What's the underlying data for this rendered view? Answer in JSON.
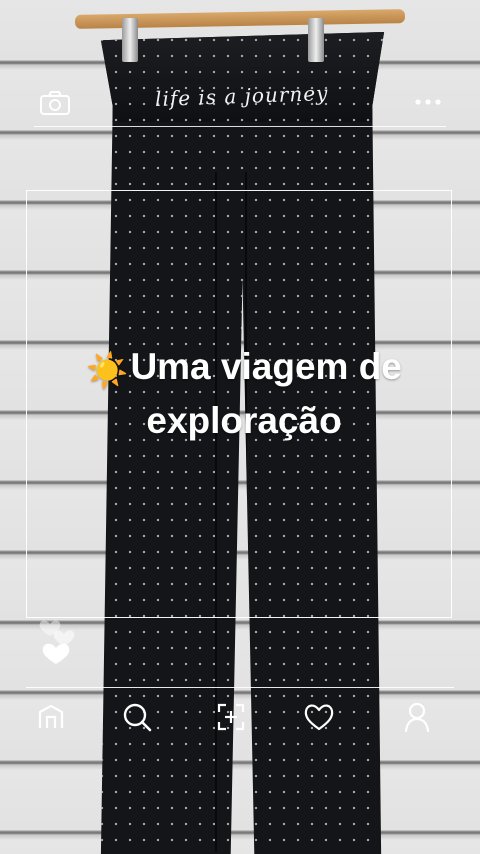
{
  "photo": {
    "embroidery_text": "life is a journey"
  },
  "overlay": {
    "title": "Uma viagem de exploração",
    "title_emoji": "☀️"
  },
  "toolbar": {
    "camera_icon": "camera-icon",
    "more_icon": "more-horizontal-icon"
  },
  "reactions": {
    "icon": "hearts-icon"
  },
  "bottom_nav": {
    "items": [
      {
        "icon": "home-icon"
      },
      {
        "icon": "search-icon"
      },
      {
        "icon": "capture-add-icon"
      },
      {
        "icon": "heart-icon"
      },
      {
        "icon": "profile-icon"
      }
    ]
  },
  "colors": {
    "overlay_stroke": "#ffffff",
    "pants": "#141518",
    "hanger": "#c89356"
  }
}
